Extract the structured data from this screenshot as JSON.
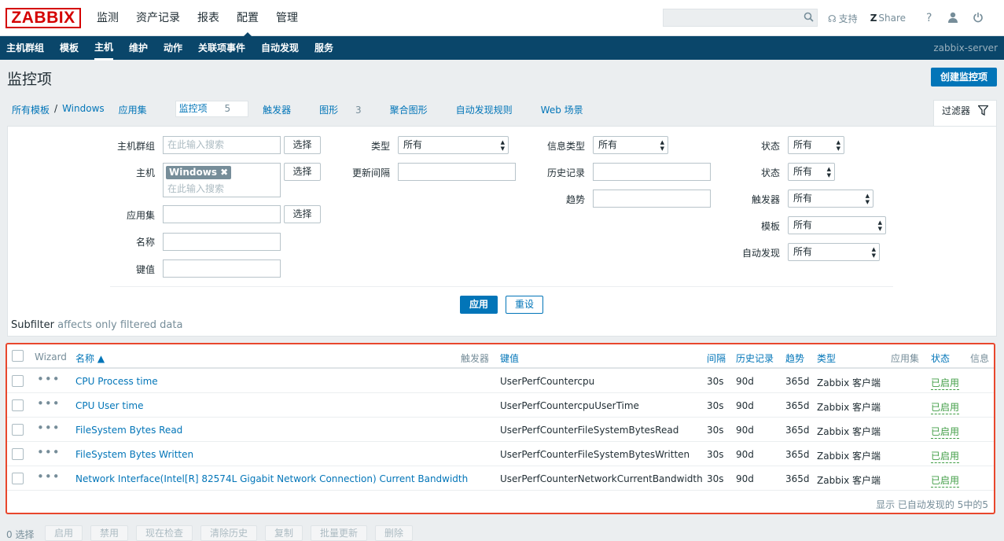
{
  "header": {
    "logo": "ZABBIX",
    "menu": [
      "监测",
      "资产记录",
      "报表",
      "配置",
      "管理"
    ],
    "active_menu": "配置",
    "toplinks": {
      "support": "支持",
      "share": "Share",
      "help": "?"
    }
  },
  "subnav": {
    "items": [
      "主机群组",
      "模板",
      "主机",
      "维护",
      "动作",
      "关联项事件",
      "自动发现",
      "服务"
    ],
    "active": "主机",
    "server": "zabbix-server"
  },
  "page": {
    "title": "监控项",
    "create_button": "创建监控项"
  },
  "breadcrumb": {
    "all_templates": "所有模板",
    "separator": "/",
    "template": "Windows",
    "tabs": [
      {
        "label": "应用集",
        "count": ""
      },
      {
        "label": "监控项",
        "count": "5"
      },
      {
        "label": "触发器",
        "count": ""
      },
      {
        "label": "图形",
        "count": "3"
      },
      {
        "label": "聚合图形",
        "count": ""
      },
      {
        "label": "自动发现规则",
        "count": ""
      },
      {
        "label": "Web 场景",
        "count": ""
      }
    ]
  },
  "filter": {
    "tab_label": "过滤器",
    "host_group_label": "主机群组",
    "host_group_placeholder": "在此输入搜索",
    "host_label": "主机",
    "host_tag": "Windows",
    "host_placeholder": "在此输入搜索",
    "app_label": "应用集",
    "name_label": "名称",
    "key_label": "键值",
    "select_button": "选择",
    "type_label": "类型",
    "type_value": "所有",
    "update_interval_label": "更新间隔",
    "info_type_label": "信息类型",
    "info_type_value": "所有",
    "history_label": "历史记录",
    "trends_label": "趋势",
    "state_label": "状态",
    "state_value": "所有",
    "status_label": "状态",
    "status_value": "所有",
    "triggers_label": "触发器",
    "triggers_value": "所有",
    "template_label": "模板",
    "template_value": "所有",
    "discovery_label": "自动发现",
    "discovery_value": "所有",
    "apply_button": "应用",
    "reset_button": "重设",
    "subfilter_title": "Subfilter",
    "subfilter_note": "affects only filtered data"
  },
  "table": {
    "headers": {
      "wizard": "Wizard",
      "name": "名称 ▲",
      "triggers": "触发器",
      "key": "键值",
      "interval": "间隔",
      "history": "历史记录",
      "trends": "趋势",
      "type": "类型",
      "applications": "应用集",
      "status": "状态",
      "info": "信息"
    },
    "rows": [
      {
        "name": "CPU Process time",
        "key": "UserPerfCountercpu",
        "interval": "30s",
        "history": "90d",
        "trends": "365d",
        "type": "Zabbix 客户端",
        "status": "已启用"
      },
      {
        "name": "CPU User time",
        "key": "UserPerfCountercpuUserTime",
        "interval": "30s",
        "history": "90d",
        "trends": "365d",
        "type": "Zabbix 客户端",
        "status": "已启用"
      },
      {
        "name": "FileSystem Bytes Read",
        "key": "UserPerfCounterFileSystemBytesRead",
        "interval": "30s",
        "history": "90d",
        "trends": "365d",
        "type": "Zabbix 客户端",
        "status": "已启用"
      },
      {
        "name": "FileSystem Bytes Written",
        "key": "UserPerfCounterFileSystemBytesWritten",
        "interval": "30s",
        "history": "90d",
        "trends": "365d",
        "type": "Zabbix 客户端",
        "status": "已启用"
      },
      {
        "name": "Network Interface(Intel[R] 82574L Gigabit Network Connection) Current Bandwidth",
        "key": "UserPerfCounterNetworkCurrentBandwidth",
        "interval": "30s",
        "history": "90d",
        "trends": "365d",
        "type": "Zabbix 客户端",
        "status": "已启用"
      }
    ],
    "footer": "显示 已自动发现的 5中的5"
  },
  "bottom": {
    "selected": "0 选择",
    "buttons": [
      "启用",
      "禁用",
      "现在检查",
      "清除历史",
      "复制",
      "批量更新",
      "删除"
    ]
  },
  "colors": {
    "accent": "#0275b8",
    "navbar": "#0a466a",
    "status_enabled": "#429e47",
    "highlight": "#e8472d"
  }
}
